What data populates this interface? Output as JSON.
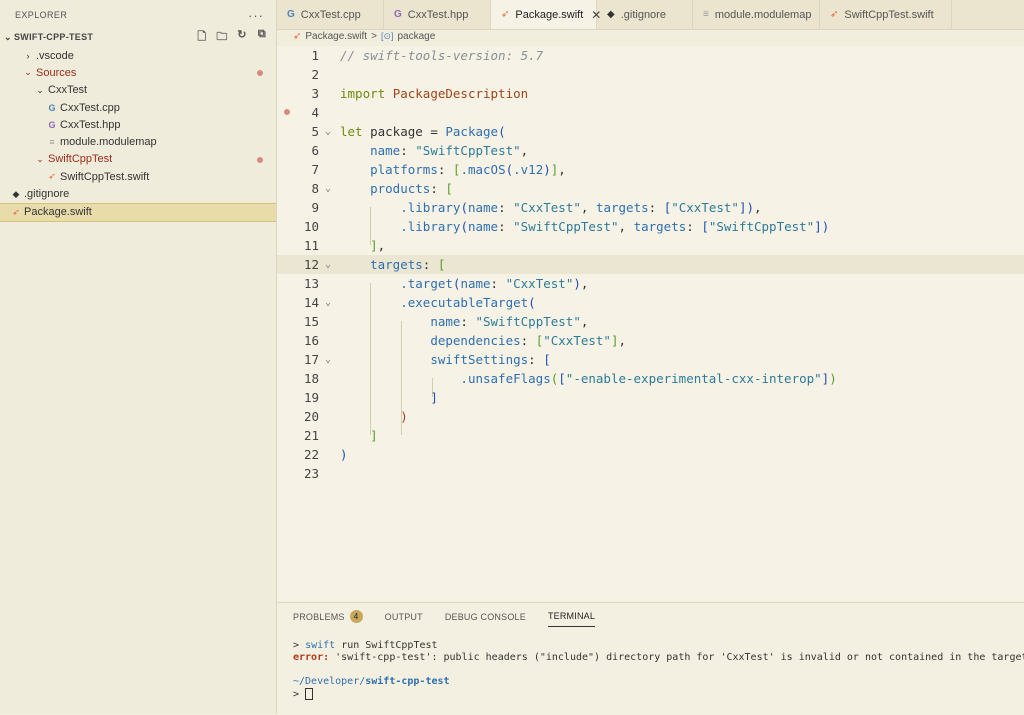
{
  "explorer": {
    "title": "EXPLORER",
    "more": "···",
    "project": "SWIFT-CPP-TEST",
    "items": [
      {
        "label": ".vscode",
        "icon": "chevron-right-icon",
        "indent": 1,
        "modified": false,
        "dot": false
      },
      {
        "label": "Sources",
        "icon": "chevron-down-icon",
        "indent": 1,
        "modified": true,
        "dot": true
      },
      {
        "label": "CxxTest",
        "icon": "chevron-down-icon",
        "indent": 2,
        "modified": false,
        "dot": false
      },
      {
        "label": "CxxTest.cpp",
        "icon": "cpp-file-icon",
        "indent": 3,
        "modified": false,
        "dot": false
      },
      {
        "label": "CxxTest.hpp",
        "icon": "hpp-file-icon",
        "indent": 3,
        "modified": false,
        "dot": false
      },
      {
        "label": "module.modulemap",
        "icon": "text-file-icon",
        "indent": 3,
        "modified": false,
        "dot": false
      },
      {
        "label": "SwiftCppTest",
        "icon": "chevron-down-icon",
        "indent": 2,
        "modified": true,
        "dot": true
      },
      {
        "label": "SwiftCppTest.swift",
        "icon": "swift-file-icon",
        "indent": 3,
        "modified": false,
        "dot": false
      },
      {
        "label": ".gitignore",
        "icon": "git-icon",
        "indent": 0,
        "modified": false,
        "dot": false
      },
      {
        "label": "Package.swift",
        "icon": "swift-file-icon",
        "indent": 0,
        "modified": false,
        "dot": false,
        "selected": true
      }
    ]
  },
  "tabs": [
    {
      "label": "CxxTest.cpp",
      "icon": "cpp-file-icon",
      "active": false
    },
    {
      "label": "CxxTest.hpp",
      "icon": "hpp-file-icon",
      "active": false
    },
    {
      "label": "Package.swift",
      "icon": "swift-file-icon",
      "active": true
    },
    {
      "label": ".gitignore",
      "icon": "git-icon",
      "active": false
    },
    {
      "label": "module.modulemap",
      "icon": "text-file-icon",
      "active": false
    },
    {
      "label": "SwiftCppTest.swift",
      "icon": "swift-file-icon",
      "active": false
    }
  ],
  "breadcrumb": {
    "file": "Package.swift",
    "separator": ">",
    "symbol": "package"
  },
  "editor": {
    "current_line": 12,
    "lines": [
      {
        "n": "1",
        "fold": false,
        "tokens": [
          [
            "c-com",
            "// swift-tools-version: 5.7"
          ]
        ]
      },
      {
        "n": "2",
        "fold": false,
        "tokens": []
      },
      {
        "n": "3",
        "fold": false,
        "tokens": [
          [
            "c-kw",
            "import "
          ],
          [
            "c-mod",
            "PackageDescription"
          ]
        ]
      },
      {
        "n": "4",
        "fold": false,
        "tokens": []
      },
      {
        "n": "5",
        "fold": true,
        "tokens": [
          [
            "c-kw",
            "let "
          ],
          [
            "",
            "package = "
          ],
          [
            "c-ty",
            "Package"
          ],
          [
            "c-br",
            "("
          ]
        ]
      },
      {
        "n": "6",
        "fold": false,
        "tokens": [
          [
            "",
            "    "
          ],
          [
            "c-fn",
            "name"
          ],
          [
            "",
            ": "
          ],
          [
            "c-str",
            "\"SwiftCppTest\""
          ],
          [
            "",
            ","
          ]
        ]
      },
      {
        "n": "7",
        "fold": false,
        "tokens": [
          [
            "",
            "    "
          ],
          [
            "c-fn",
            "platforms"
          ],
          [
            "",
            ": "
          ],
          [
            "c-br2",
            "["
          ],
          [
            "c-fn",
            ".macOS"
          ],
          [
            "c-br",
            "("
          ],
          [
            "c-fn",
            ".v12"
          ],
          [
            "c-br",
            ")"
          ],
          [
            "c-br2",
            "]"
          ],
          [
            "",
            ","
          ]
        ]
      },
      {
        "n": "8",
        "fold": true,
        "tokens": [
          [
            "",
            "    "
          ],
          [
            "c-fn",
            "products"
          ],
          [
            "",
            ": "
          ],
          [
            "c-br2",
            "["
          ]
        ]
      },
      {
        "n": "9",
        "fold": false,
        "tokens": [
          [
            "",
            "        "
          ],
          [
            "c-fn",
            ".library"
          ],
          [
            "c-br",
            "("
          ],
          [
            "c-fn",
            "name"
          ],
          [
            "",
            ": "
          ],
          [
            "c-str",
            "\"CxxTest\""
          ],
          [
            "",
            ", "
          ],
          [
            "c-fn",
            "targets"
          ],
          [
            "",
            ": "
          ],
          [
            "c-br",
            "["
          ],
          [
            "c-str",
            "\"CxxTest\""
          ],
          [
            "c-br",
            "]"
          ],
          [
            "c-br",
            ")"
          ],
          [
            "",
            ","
          ]
        ]
      },
      {
        "n": "10",
        "fold": false,
        "tokens": [
          [
            "",
            "        "
          ],
          [
            "c-fn",
            ".library"
          ],
          [
            "c-br",
            "("
          ],
          [
            "c-fn",
            "name"
          ],
          [
            "",
            ": "
          ],
          [
            "c-str",
            "\"SwiftCppTest\""
          ],
          [
            "",
            ", "
          ],
          [
            "c-fn",
            "targets"
          ],
          [
            "",
            ": "
          ],
          [
            "c-br",
            "["
          ],
          [
            "c-str",
            "\"SwiftCppTest\""
          ],
          [
            "c-br",
            "]"
          ],
          [
            "c-br",
            ")"
          ]
        ]
      },
      {
        "n": "11",
        "fold": false,
        "tokens": [
          [
            "",
            "    "
          ],
          [
            "c-br2",
            "]"
          ],
          [
            "",
            ","
          ]
        ]
      },
      {
        "n": "12",
        "fold": true,
        "tokens": [
          [
            "",
            "    "
          ],
          [
            "c-fn",
            "targets"
          ],
          [
            "",
            ": "
          ],
          [
            "c-br2",
            "["
          ]
        ]
      },
      {
        "n": "13",
        "fold": false,
        "tokens": [
          [
            "",
            "        "
          ],
          [
            "c-fn",
            ".target"
          ],
          [
            "c-br",
            "("
          ],
          [
            "c-fn",
            "name"
          ],
          [
            "",
            ": "
          ],
          [
            "c-str",
            "\"CxxTest\""
          ],
          [
            "c-br",
            ")"
          ],
          [
            "",
            ","
          ]
        ]
      },
      {
        "n": "14",
        "fold": true,
        "tokens": [
          [
            "",
            "        "
          ],
          [
            "c-fn",
            ".executableTarget"
          ],
          [
            "c-br",
            "("
          ]
        ]
      },
      {
        "n": "15",
        "fold": false,
        "tokens": [
          [
            "",
            "            "
          ],
          [
            "c-fn",
            "name"
          ],
          [
            "",
            ": "
          ],
          [
            "c-str",
            "\"SwiftCppTest\""
          ],
          [
            "",
            ","
          ]
        ]
      },
      {
        "n": "16",
        "fold": false,
        "tokens": [
          [
            "",
            "            "
          ],
          [
            "c-fn",
            "dependencies"
          ],
          [
            "",
            ": "
          ],
          [
            "c-br2",
            "["
          ],
          [
            "c-str",
            "\"CxxTest\""
          ],
          [
            "c-br2",
            "]"
          ],
          [
            "",
            ","
          ]
        ]
      },
      {
        "n": "17",
        "fold": true,
        "tokens": [
          [
            "",
            "            "
          ],
          [
            "c-fn",
            "swiftSettings"
          ],
          [
            "",
            ": "
          ],
          [
            "c-br",
            "["
          ]
        ]
      },
      {
        "n": "18",
        "fold": false,
        "tokens": [
          [
            "",
            "                "
          ],
          [
            "c-fn",
            ".unsafeFlags"
          ],
          [
            "c-br2",
            "("
          ],
          [
            "c-br",
            "["
          ],
          [
            "c-str",
            "\"-enable-experimental-cxx-interop\""
          ],
          [
            "c-br",
            "]"
          ],
          [
            "c-br2",
            ")"
          ]
        ]
      },
      {
        "n": "19",
        "fold": false,
        "tokens": [
          [
            "",
            "            "
          ],
          [
            "c-br",
            "]"
          ]
        ]
      },
      {
        "n": "20",
        "fold": false,
        "tokens": [
          [
            "",
            "        "
          ],
          [
            "c-mod",
            ")"
          ]
        ]
      },
      {
        "n": "21",
        "fold": false,
        "tokens": [
          [
            "",
            "    "
          ],
          [
            "c-br2",
            "]"
          ]
        ]
      },
      {
        "n": "22",
        "fold": false,
        "tokens": [
          [
            "c-br",
            ")"
          ]
        ]
      },
      {
        "n": "23",
        "fold": false,
        "tokens": []
      }
    ]
  },
  "panel": {
    "tabs": [
      {
        "label": "PROBLEMS",
        "badge": "4",
        "active": false
      },
      {
        "label": "OUTPUT",
        "active": false
      },
      {
        "label": "DEBUG CONSOLE",
        "active": false
      },
      {
        "label": "TERMINAL",
        "active": true
      }
    ],
    "terminal": {
      "prompt": ">",
      "command_kw": "swift",
      "command_rest": " run SwiftCppTest",
      "error_label": "error:",
      "error_text": " 'swift-cpp-test': public headers (\"include\") directory path for 'CxxTest' is invalid or not contained in the target",
      "cwd_prefix": "~/Developer/",
      "cwd_bold": "swift-cpp-test"
    }
  },
  "colors": {
    "accent": "#c7a85a",
    "modified": "#9b2c1c",
    "selection": "#e8dcaa"
  }
}
